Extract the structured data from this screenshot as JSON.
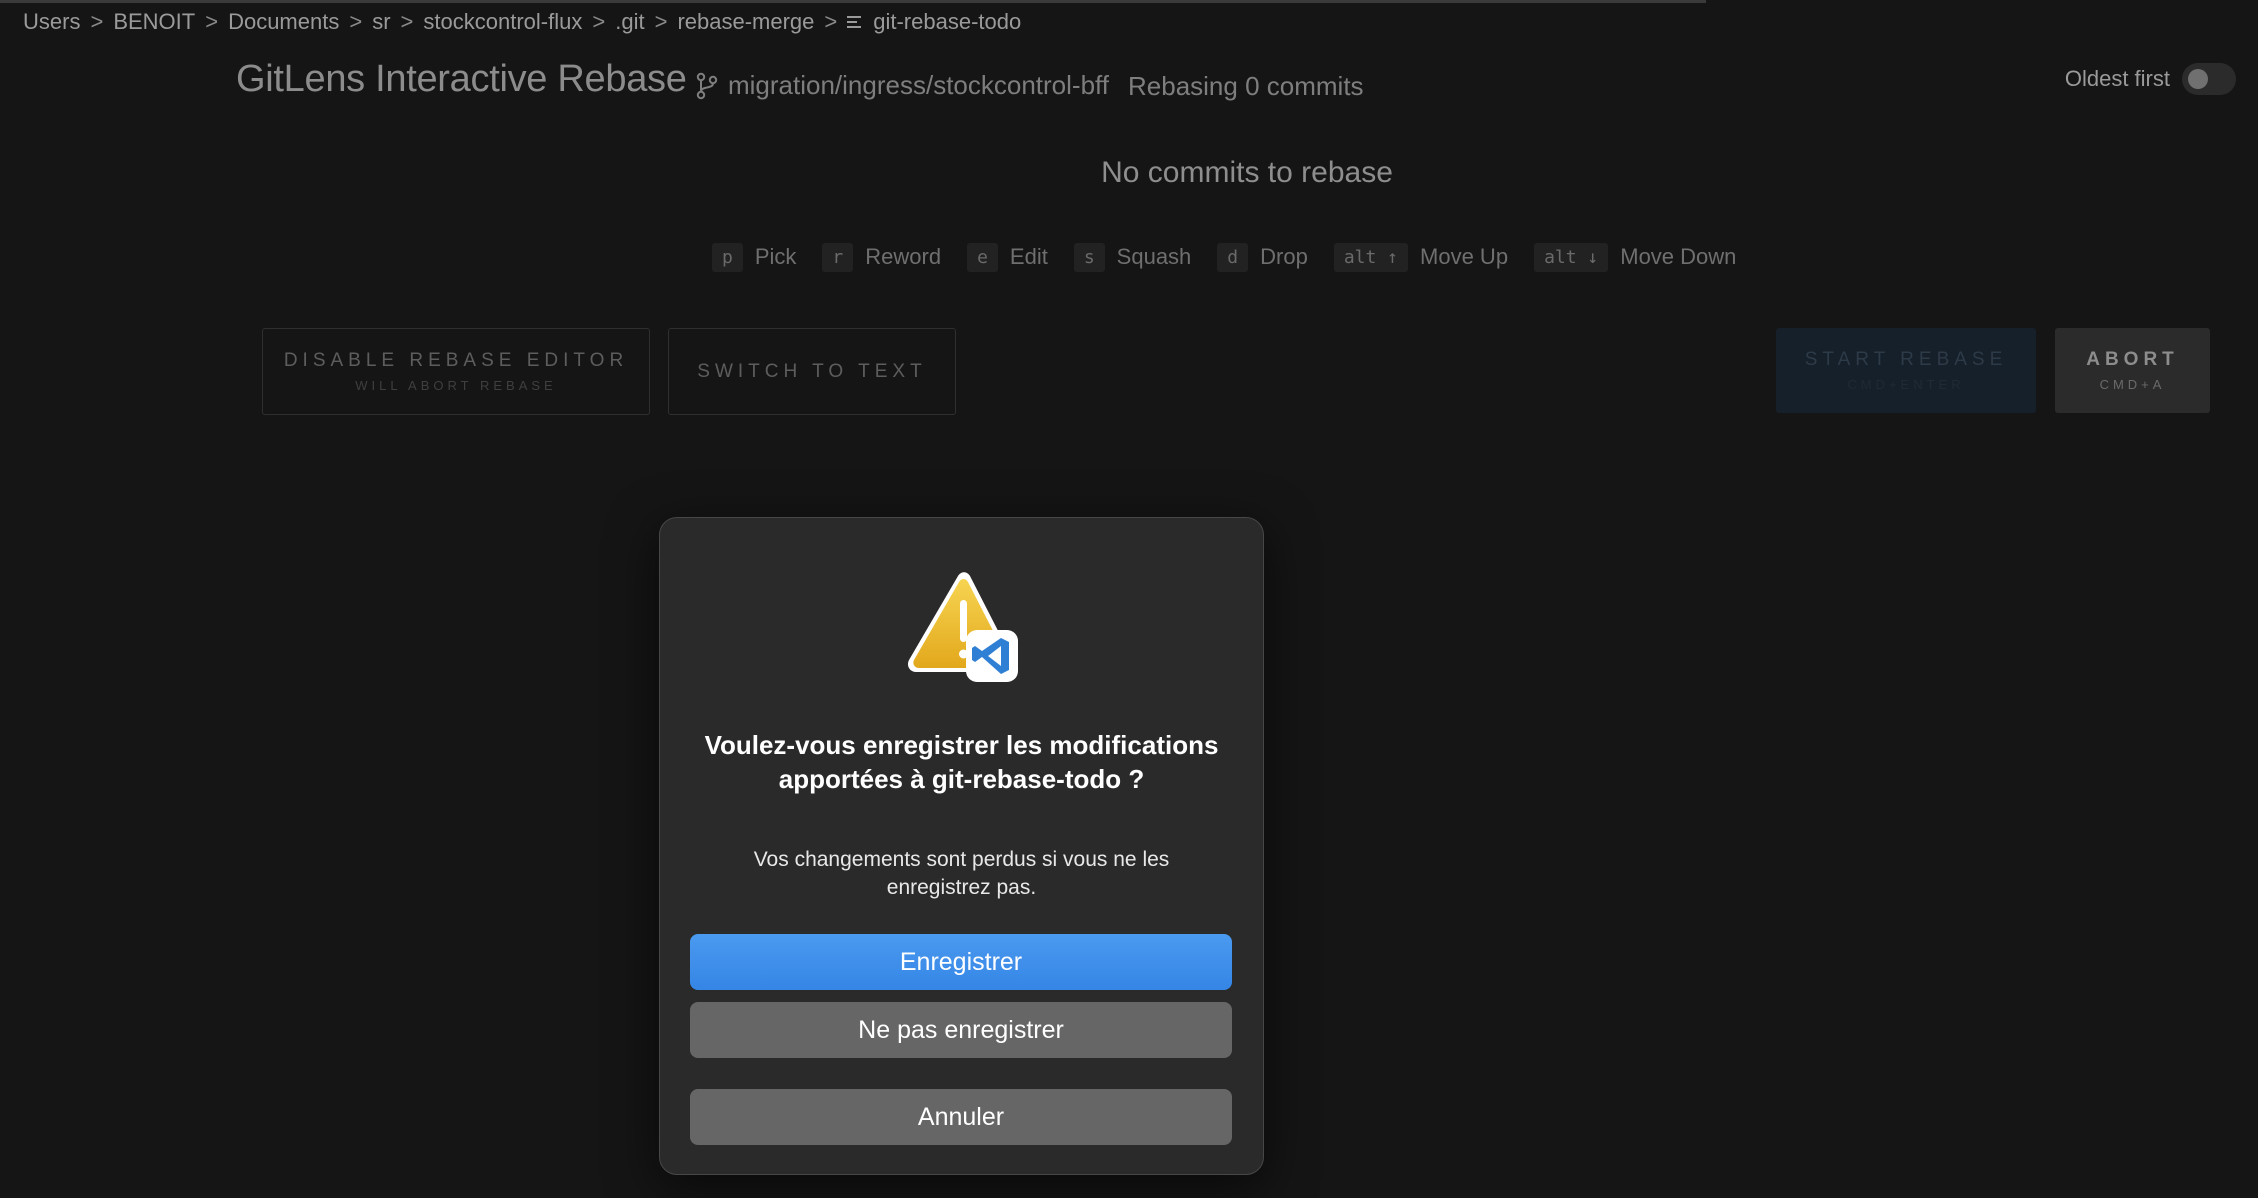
{
  "breadcrumb": {
    "items": [
      "Users",
      "BENOIT",
      "Documents",
      "sr",
      "stockcontrol-flux",
      ".git",
      "rebase-merge"
    ],
    "file": "git-rebase-todo",
    "file_icon": "file-lines-icon",
    "separator": ">"
  },
  "header": {
    "title": "GitLens Interactive Rebase",
    "branch_icon": "git-branch-icon",
    "branch": "migration/ingress/stockcontrol-bff",
    "rebasing": "Rebasing 0 commits",
    "oldest_first_label": "Oldest first",
    "oldest_first_on": false
  },
  "empty_message": "No commits to rebase",
  "shortcuts": [
    {
      "key": "p",
      "label": "Pick"
    },
    {
      "key": "r",
      "label": "Reword"
    },
    {
      "key": "e",
      "label": "Edit"
    },
    {
      "key": "s",
      "label": "Squash"
    },
    {
      "key": "d",
      "label": "Drop"
    },
    {
      "key": "alt ↑",
      "label": "Move Up"
    },
    {
      "key": "alt ↓",
      "label": "Move Down"
    }
  ],
  "actions": {
    "disable_label": "DISABLE REBASE EDITOR",
    "disable_sub": "WILL ABORT REBASE",
    "switch_label": "SWITCH TO TEXT",
    "start_label": "START REBASE",
    "start_sub": "CMD+ENTER",
    "abort_label": "ABORT",
    "abort_sub": "CMD+A"
  },
  "dialog": {
    "icon": "warning-vscode-icon",
    "title": "Voulez-vous enregistrer les modifications apportées à git-rebase-todo ?",
    "message": "Vos changements sont perdus si vous ne les enregistrez pas.",
    "save_label": "Enregistrer",
    "dont_save_label": "Ne pas enregistrer",
    "cancel_label": "Annuler"
  },
  "colors": {
    "background": "#151515",
    "primary_button": "#3d8ef0",
    "secondary_button": "#666666",
    "warning": "#f2c230",
    "vscode_blue": "#2f7fd4"
  }
}
